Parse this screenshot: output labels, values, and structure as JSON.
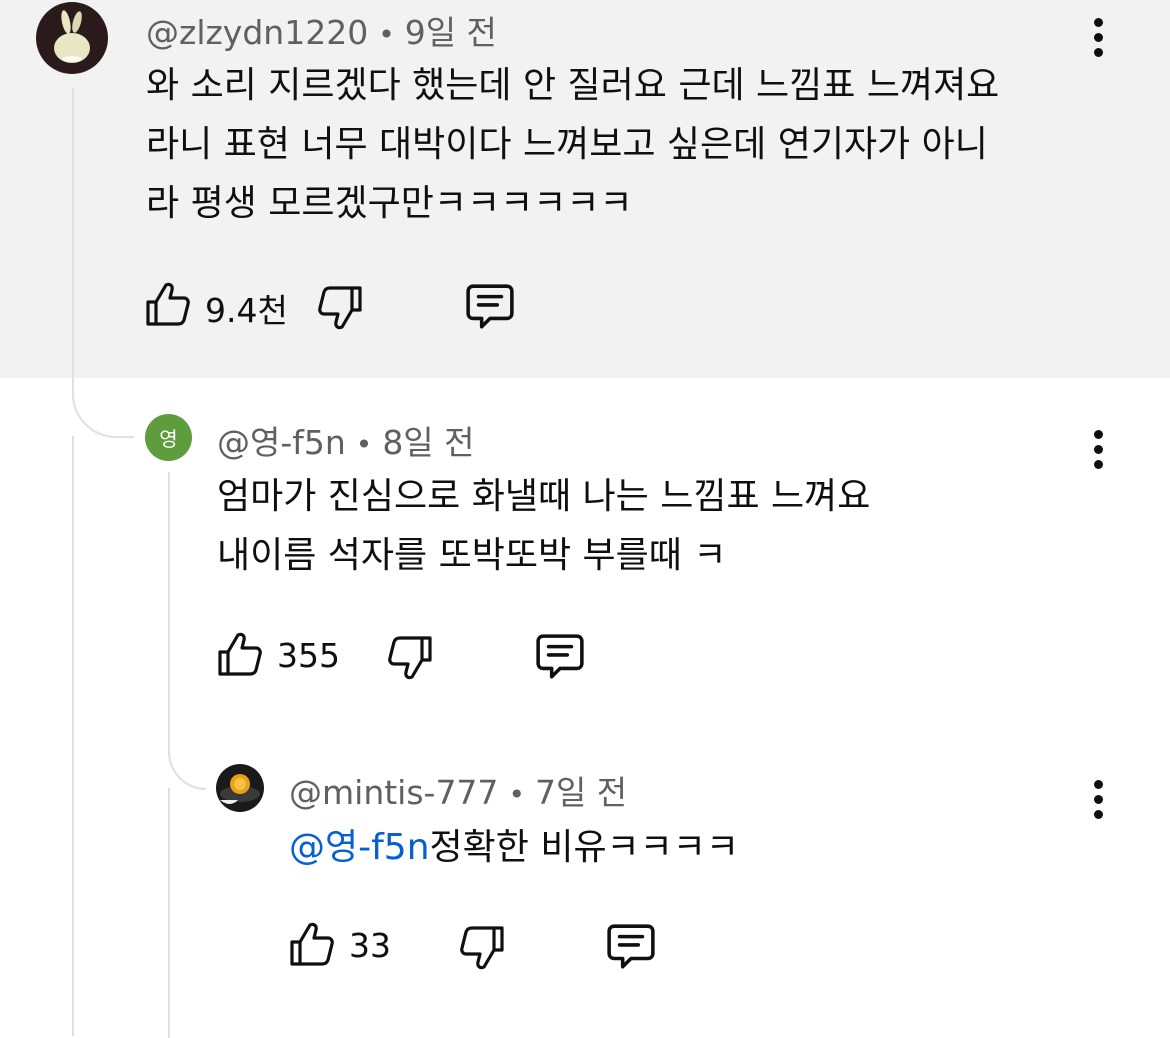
{
  "comments": [
    {
      "handle": "@zlzydn1220",
      "time": "9일 전",
      "lines": [
        "와 소리 지르겠다 했는데 안 질러요 근데 느낌표 느껴져요",
        "라니 표현 너무 대박이다 느껴보고 싶은데 연기자가 아니",
        "라 평생 모르겠구만ㅋㅋㅋㅋㅋㅋ"
      ],
      "likes": "9.4천",
      "avatar_icon": "bunny-avatar-icon"
    },
    {
      "handle": "@영-f5n",
      "avatar_letter": "영",
      "avatar_color": "#5f9c3d",
      "time": "8일 전",
      "lines": [
        "엄마가 진심으로 화낼때 나는 느낌표 느껴요",
        "내이름 석자를 또박또박 부를때 ㅋ"
      ],
      "likes": "355"
    },
    {
      "handle": "@mintis-777",
      "time": "7일 전",
      "mention": "@영-f5n",
      "text": "정확한 비유ㅋㅋㅋㅋ",
      "likes": "33",
      "avatar_icon": "lemon-plate-avatar-icon"
    }
  ],
  "icons": [
    "like-icon",
    "dislike-icon",
    "reply-icon",
    "more-options-icon"
  ],
  "colors": {
    "highlight_bg": "#f2f2f2",
    "mention": "#065fd4",
    "meta": "#606060"
  }
}
